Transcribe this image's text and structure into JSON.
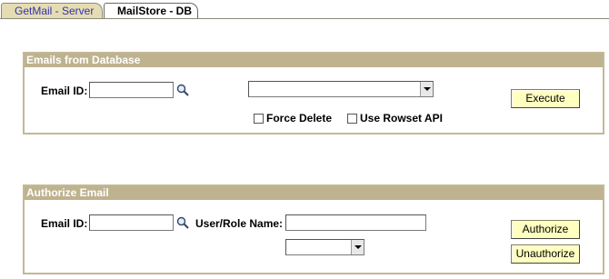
{
  "tabs": [
    {
      "label": "GetMail - Server",
      "active": false
    },
    {
      "label": "MailStore - DB",
      "active": true
    }
  ],
  "emails_from_database": {
    "header": "Emails from Database",
    "email_id_label": "Email ID:",
    "email_id_value": "",
    "dropdown_value": "",
    "force_delete_label": "Force Delete",
    "force_delete_checked": false,
    "use_rowset_api_label": "Use Rowset API",
    "use_rowset_api_checked": false,
    "execute_label": "Execute"
  },
  "authorize_email": {
    "header": "Authorize Email",
    "email_id_label": "Email ID:",
    "email_id_value": "",
    "user_role_label": "User/Role Name:",
    "user_role_value": "",
    "dropdown_value": "",
    "authorize_label": "Authorize",
    "unauthorize_label": "Unauthorize"
  },
  "icons": {
    "lookup": "magnifier-icon",
    "dropdown": "chevron-down-icon"
  },
  "colors": {
    "header_bg": "#beb28f",
    "button_bg": "#ffffc0",
    "inactive_tab_bg": "#e6dcb4",
    "inactive_tab_text": "#3333aa"
  }
}
